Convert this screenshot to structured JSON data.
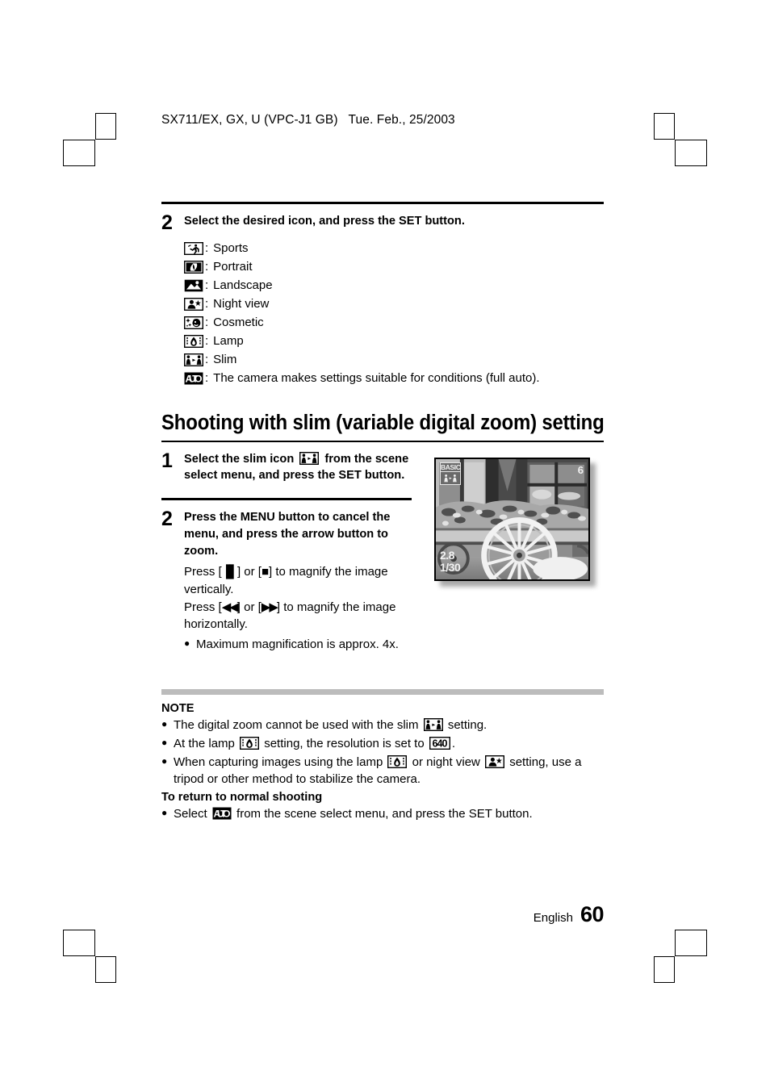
{
  "document": {
    "header": "SX711/EX, GX, U (VPC-J1 GB)   Tue. Feb., 25/2003",
    "footer_language": "English",
    "footer_page": "60"
  },
  "step2_top": {
    "number": "2",
    "title": "Select the desired icon, and press the SET button.",
    "icon_list": [
      {
        "icon": "sports-icon",
        "colon": ":",
        "label": "Sports"
      },
      {
        "icon": "portrait-icon",
        "colon": ":",
        "label": "Portrait"
      },
      {
        "icon": "landscape-icon",
        "colon": ":",
        "label": "Landscape"
      },
      {
        "icon": "night-view-icon",
        "colon": ":",
        "label": "Night view"
      },
      {
        "icon": "cosmetic-icon",
        "colon": ":",
        "label": "Cosmetic"
      },
      {
        "icon": "lamp-icon",
        "colon": ":",
        "label": "Lamp"
      },
      {
        "icon": "slim-icon",
        "colon": ":",
        "label": "Slim"
      },
      {
        "icon": "auto-icon",
        "colon": ":",
        "label": "The camera makes settings suitable for conditions (full auto)."
      }
    ]
  },
  "section": {
    "heading": "Shooting with slim (variable digital zoom) setting"
  },
  "step1": {
    "number": "1",
    "title_part1": "Select the slim icon",
    "title_part2": "from the scene select menu, and press the SET button."
  },
  "step2": {
    "number": "2",
    "title": "Press the MENU button to cancel the menu, and press the arrow button to zoom.",
    "line1_pre": "Press [",
    "line1_mid": "] or [",
    "line1_post": "] to magnify the image vertically.",
    "line2_pre": "Press [",
    "line2_mid": "] or [",
    "line2_post": "] to magnify the image horizontally.",
    "bullet_dot": "●",
    "bullet": "Maximum magnification is approx. 4x."
  },
  "photo": {
    "alt": "camera-lcd-preview",
    "overlay_quality": "BASIC",
    "overlay_icon": "slim-icon",
    "overlay_count": "6",
    "overlay_aperture": "2.8",
    "overlay_shutter": "1/30"
  },
  "note": {
    "title": "NOTE",
    "bullet_dot": "●",
    "items": [
      {
        "pre": "The digital zoom cannot be used with the slim",
        "icon": "slim-icon",
        "post": "setting."
      },
      {
        "pre": "At the lamp",
        "icon": "lamp-icon",
        "mid": "setting, the resolution is set to",
        "icon2": "res640-icon",
        "post": "."
      },
      {
        "pre": "When capturing images using the lamp",
        "icon": "lamp-icon",
        "mid": "or night view",
        "icon2": "night-view-icon",
        "post": "setting, use a tripod or other method to stabilize the camera."
      }
    ],
    "subtitle": "To return to normal shooting",
    "return_pre": "Select",
    "return_icon": "auto-icon",
    "return_post": "from the scene select menu, and press the SET button."
  },
  "symbols": {
    "pause": "▐▌",
    "stop": "■",
    "rewind": "◀◀",
    "forward": "▶▶"
  },
  "colors": {
    "ink": "#000000",
    "gray_rule": "#bcbcbc"
  }
}
